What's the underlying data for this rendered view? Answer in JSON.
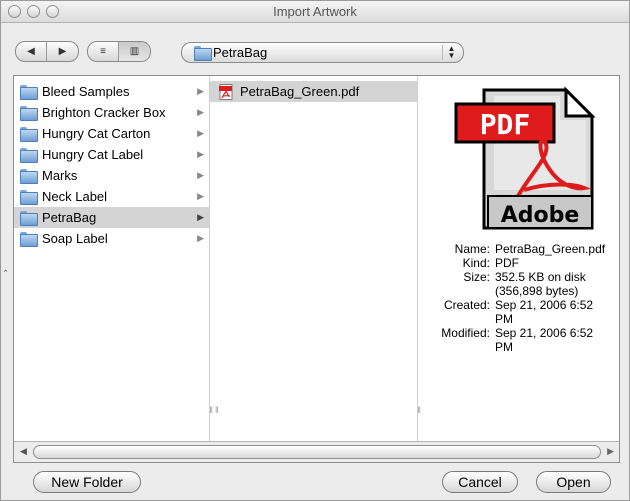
{
  "window": {
    "title": "Import Artwork"
  },
  "toolbar": {
    "back_glyph": "◀",
    "forward_glyph": "▶",
    "list_view_glyph": "≡",
    "column_view_glyph": "▥",
    "location": "PetraBag"
  },
  "columns": {
    "col1": [
      {
        "label": "Bleed Samples"
      },
      {
        "label": "Brighton Cracker Box"
      },
      {
        "label": "Hungry Cat Carton"
      },
      {
        "label": "Hungry Cat Label"
      },
      {
        "label": "Marks"
      },
      {
        "label": "Neck Label"
      },
      {
        "label": "PetraBag",
        "selected": true
      },
      {
        "label": "Soap Label"
      }
    ],
    "col2": [
      {
        "label": "PetraBag_Green.pdf",
        "selected": true
      }
    ]
  },
  "preview": {
    "badge_text": "PDF",
    "brand_text": "Adobe",
    "info": [
      {
        "key": "Name:",
        "value": "PetraBag_Green.pdf"
      },
      {
        "key": "Kind:",
        "value": "PDF"
      },
      {
        "key": "Size:",
        "value": "352.5 KB on disk"
      },
      {
        "key": "",
        "value": "(356,898 bytes)"
      },
      {
        "key": "Created:",
        "value": "Sep 21, 2006 6:52"
      },
      {
        "key": "",
        "value": "PM"
      },
      {
        "key": "Modified:",
        "value": "Sep 21, 2006 6:52"
      },
      {
        "key": "",
        "value": "PM"
      }
    ]
  },
  "buttons": {
    "new_folder": "New Folder",
    "cancel": "Cancel",
    "open": "Open"
  },
  "colors": {
    "selection": "#d4d4d4",
    "folder": "#6e9ed4",
    "pdf_red": "#e01b1b"
  }
}
